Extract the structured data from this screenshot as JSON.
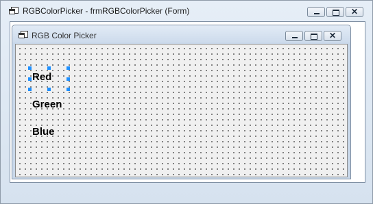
{
  "outer_window": {
    "title": "RGBColorPicker - frmRGBColorPicker (Form)",
    "controls": {
      "minimize": "minimize",
      "maximize": "maximize",
      "close": "✕"
    }
  },
  "form_window": {
    "title": "RGB Color Picker",
    "controls": {
      "minimize": "minimize",
      "maximize": "maximize",
      "close": "✕"
    }
  },
  "design_surface": {
    "labels": [
      {
        "name": "red",
        "text": "Red",
        "selected": true
      },
      {
        "name": "green",
        "text": "Green",
        "selected": false
      },
      {
        "name": "blue",
        "text": "Blue",
        "selected": false
      }
    ]
  },
  "colors": {
    "selection_handle": "#1e90ff",
    "grid_background": "#f0f0f0",
    "title_bar": "#d6e2ef"
  }
}
